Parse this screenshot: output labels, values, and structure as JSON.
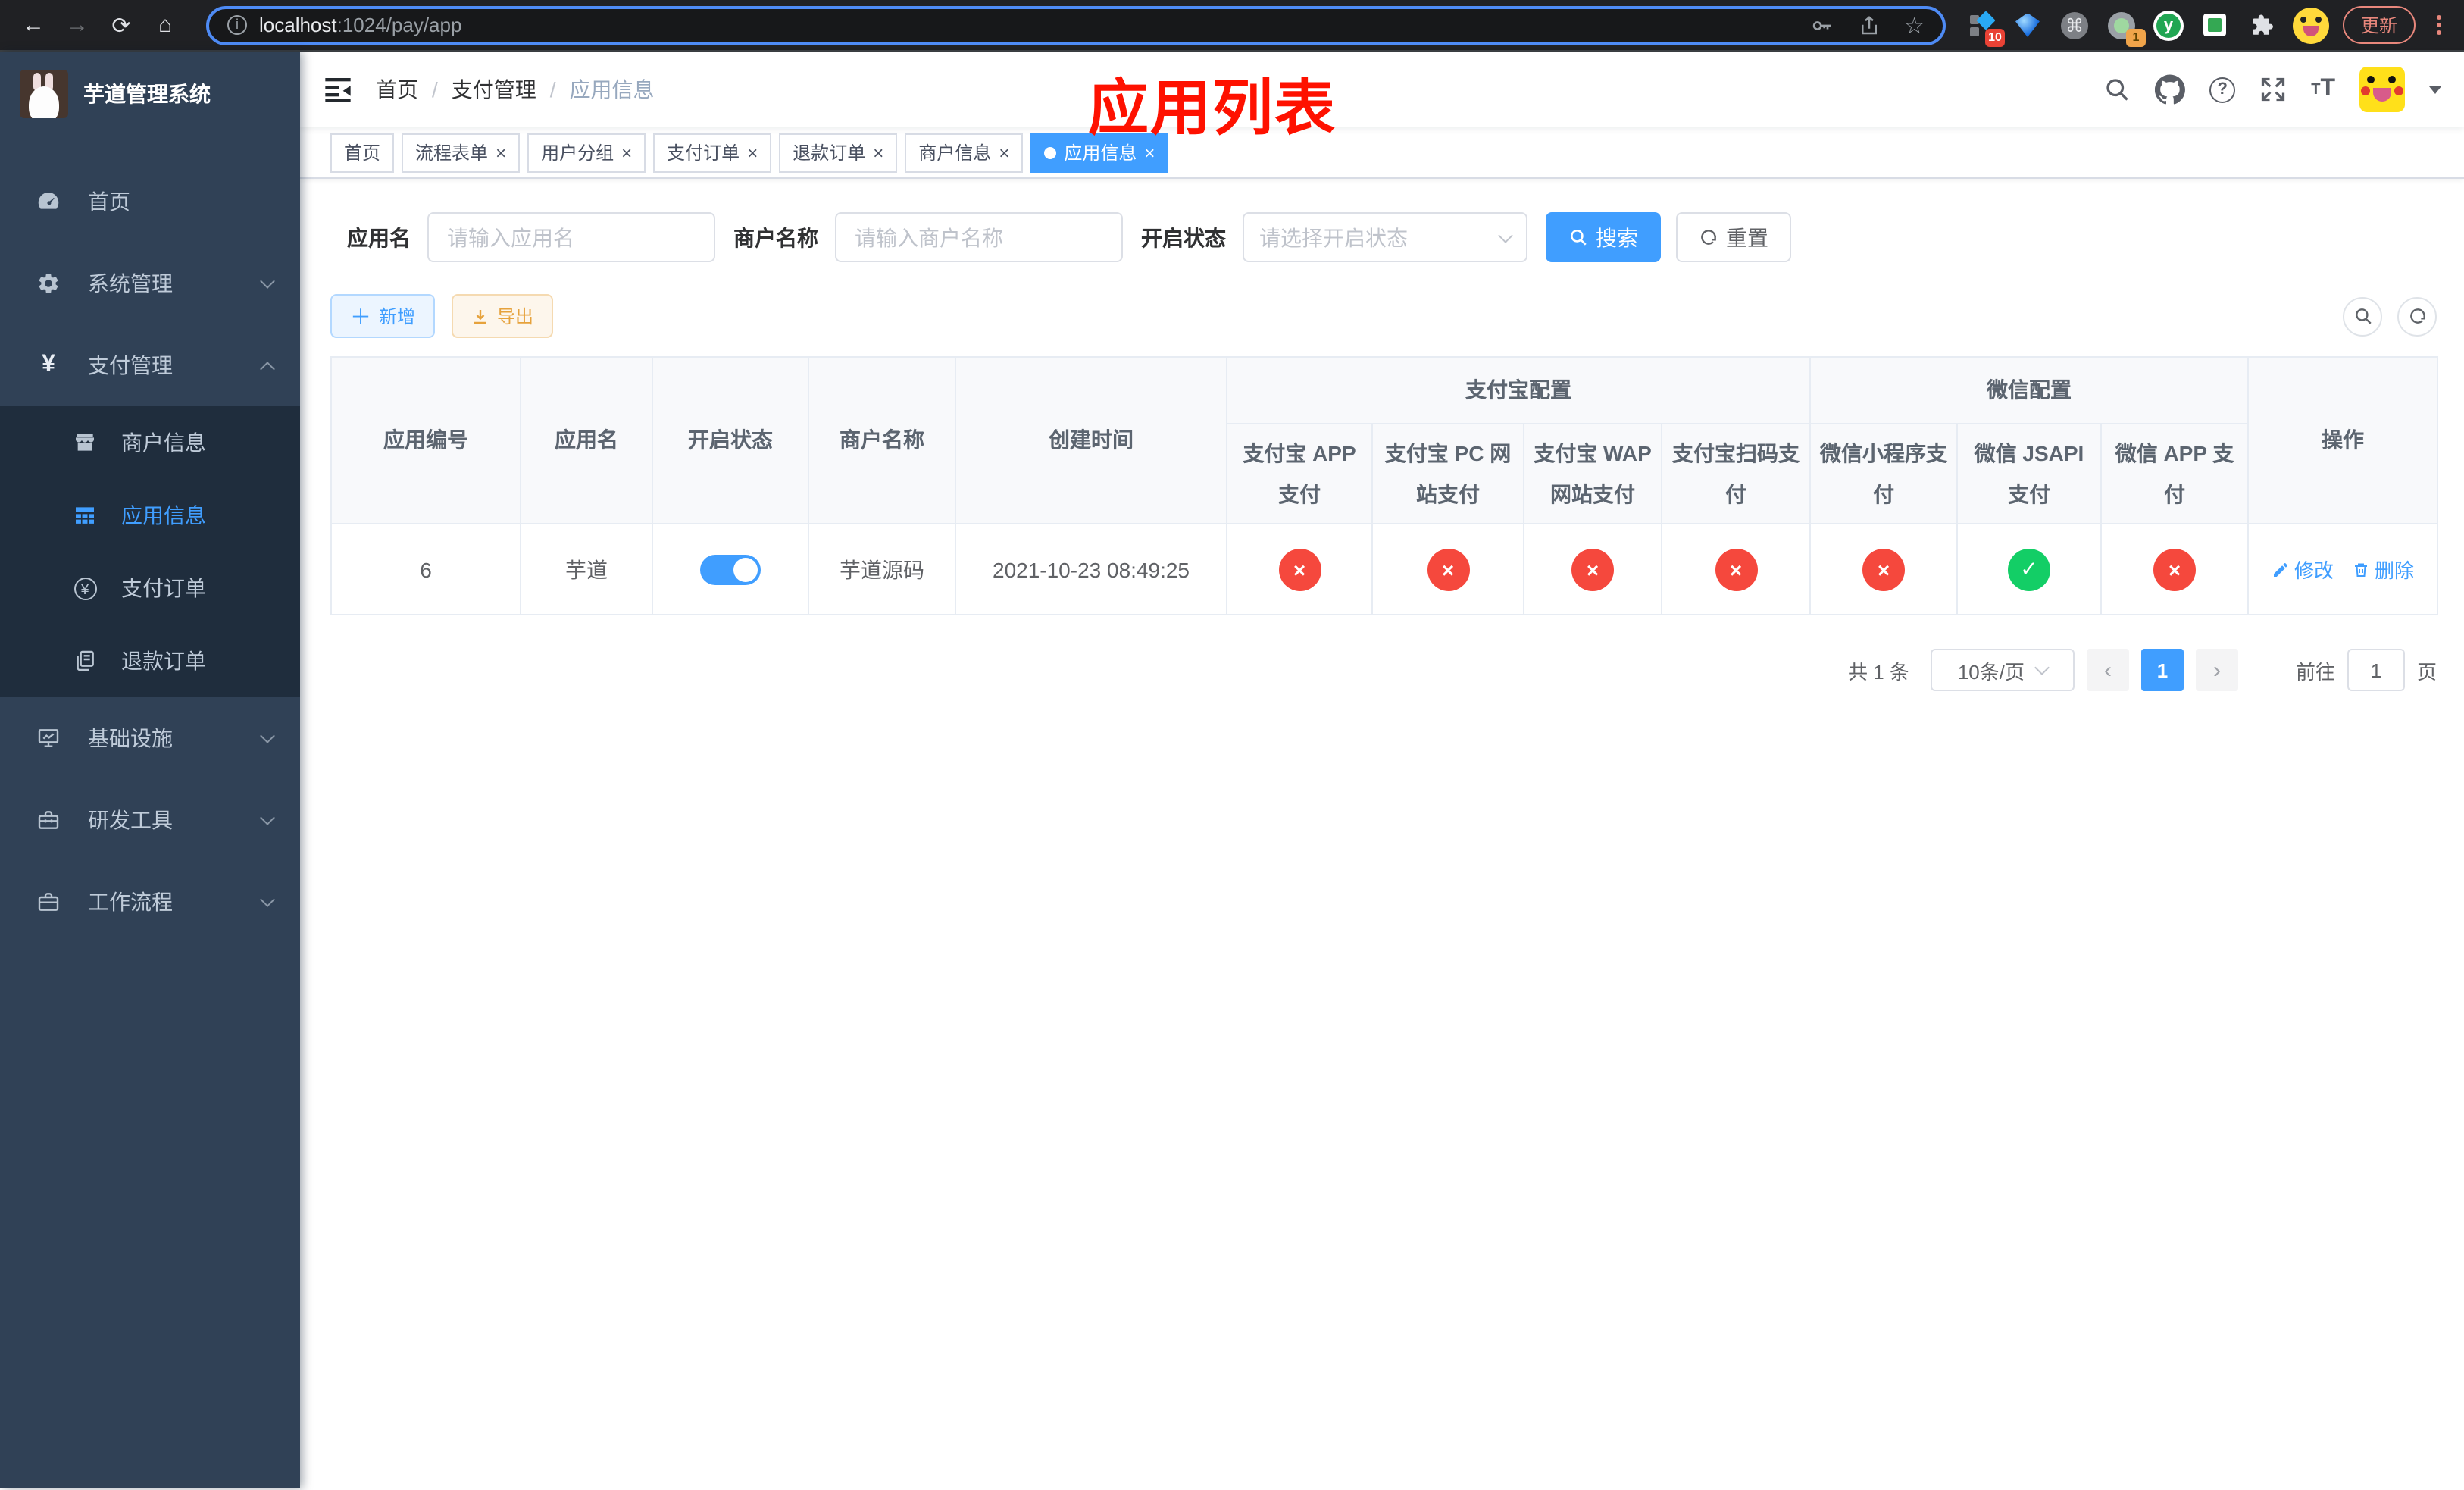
{
  "browser": {
    "url_host": "localhost",
    "url_rest": ":1024/pay/app",
    "update_label": "更新",
    "ext_badge_10": "10",
    "ext_badge_1": "1",
    "ext_y_label": "y"
  },
  "icons": {
    "back": "←",
    "forward": "→",
    "reload": "⟳",
    "home": "⌂",
    "info": "i",
    "star": "☆",
    "command": "⌘",
    "close": "×",
    "plus": "＋",
    "sep": "/",
    "help": "?",
    "font_small": "T",
    "font_big": "T",
    "yen": "¥",
    "check": "✓",
    "cross": "×",
    "prev": "‹",
    "next": "›"
  },
  "sidebar": {
    "title": "芋道管理系统",
    "menu": [
      {
        "label": "首页"
      },
      {
        "label": "系统管理"
      },
      {
        "label": "支付管理"
      },
      {
        "label": "商户信息"
      },
      {
        "label": "应用信息"
      },
      {
        "label": "支付订单"
      },
      {
        "label": "退款订单"
      },
      {
        "label": "基础设施"
      },
      {
        "label": "研发工具"
      },
      {
        "label": "工作流程"
      }
    ]
  },
  "navbar": {
    "breadcrumb": {
      "home": "首页",
      "section": "支付管理",
      "current": "应用信息"
    },
    "annotation": "应用列表"
  },
  "tabs": [
    {
      "label": "首页"
    },
    {
      "label": "流程表单"
    },
    {
      "label": "用户分组"
    },
    {
      "label": "支付订单"
    },
    {
      "label": "退款订单"
    },
    {
      "label": "商户信息"
    },
    {
      "label": "应用信息"
    }
  ],
  "filters": {
    "app_name_label": "应用名",
    "app_name_placeholder": "请输入应用名",
    "merchant_label": "商户名称",
    "merchant_placeholder": "请输入商户名称",
    "status_label": "开启状态",
    "status_placeholder": "请选择开启状态",
    "search_label": "搜索",
    "reset_label": "重置"
  },
  "toolbar": {
    "add_label": "新增",
    "export_label": "导出"
  },
  "table": {
    "group_headers": [
      "支付宝配置",
      "微信配置"
    ],
    "columns": [
      "应用编号",
      "应用名",
      "开启状态",
      "商户名称",
      "创建时间",
      "支付宝 APP 支付",
      "支付宝 PC 网站支付",
      "支付宝 WAP 网站支付",
      "支付宝扫码支付",
      "微信小程序支付",
      "微信 JSAPI 支付",
      "微信 APP 支付",
      "操作"
    ],
    "rows": [
      {
        "id": "6",
        "name": "芋道",
        "enabled": true,
        "merchant": "芋道源码",
        "created": "2021-10-23 08:49:25",
        "statuses": [
          "disabled",
          "disabled",
          "disabled",
          "disabled",
          "disabled",
          "enabled",
          "disabled"
        ],
        "edit_label": "修改",
        "delete_label": "删除"
      }
    ]
  },
  "pagination": {
    "total": "共 1 条",
    "page_size": "10条/页",
    "current_page": "1",
    "goto_label": "前往",
    "goto_value": "1",
    "page_suffix": "页"
  },
  "colors": {
    "accent": "#409eff",
    "success": "#13ce66",
    "danger": "#f5483d",
    "warning": "#e6a23c",
    "annotation_red": "#fe1100",
    "sidebar_bg": "#304156",
    "submenu_bg": "#1f2d3d"
  }
}
